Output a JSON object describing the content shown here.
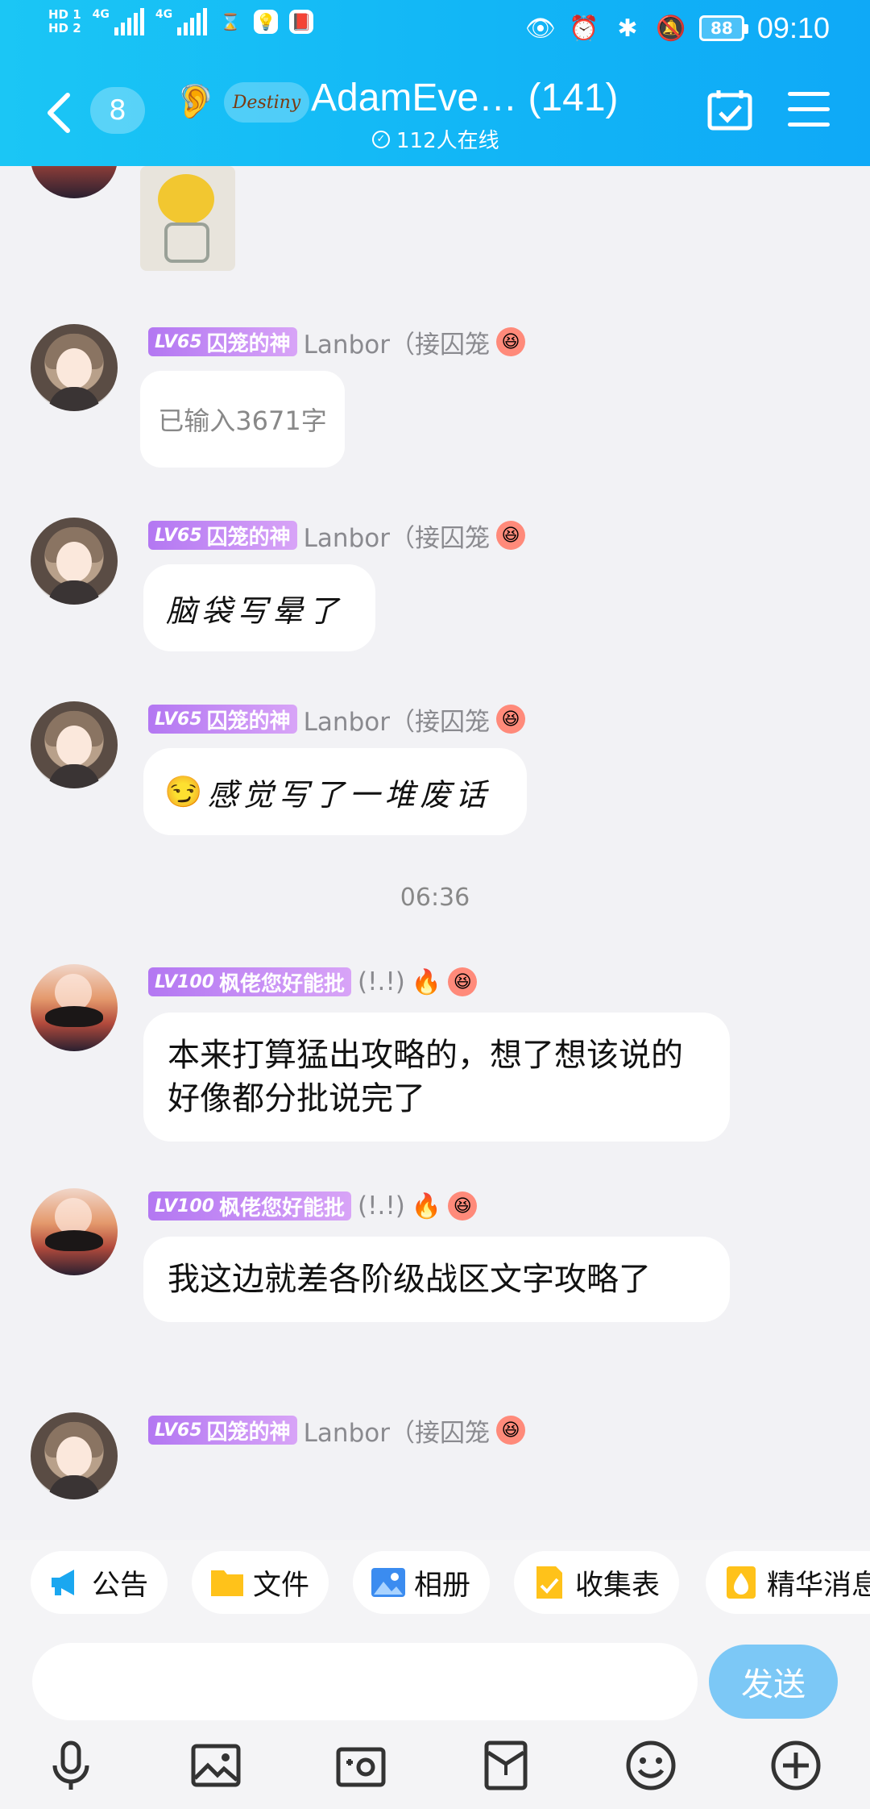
{
  "status_bar": {
    "sim1": "HD 1",
    "sim2": "HD 2",
    "network1": "4G",
    "network2": "4G",
    "battery": "88",
    "time": "09:10"
  },
  "header": {
    "unread_count": "8",
    "group_logo_text": "Destiny",
    "group_title": "AdamEve… (141)",
    "online_text": "112人在线"
  },
  "messages": [
    {
      "type": "sticker"
    },
    {
      "badge_level": "LV65",
      "badge_title": "囚笼的神",
      "nick": "Lanbor（接囚笼",
      "text": "已输入3671字"
    },
    {
      "badge_level": "LV65",
      "badge_title": "囚笼的神",
      "nick": "Lanbor（接囚笼",
      "text": "脑袋写晕了"
    },
    {
      "badge_level": "LV65",
      "badge_title": "囚笼的神",
      "nick": "Lanbor（接囚笼",
      "text": "感觉写了一堆废话"
    },
    {
      "badge_level": "LV100",
      "badge_title": "枫佬您好能批",
      "nick": "(!.!)",
      "text": "本来打算猛出攻略的，想了想该说的好像都分批说完了"
    },
    {
      "badge_level": "LV100",
      "badge_title": "枫佬您好能批",
      "nick": "(!.!)",
      "text": "我这边就差各阶级战区文字攻略了"
    },
    {
      "badge_level": "LV65",
      "badge_title": "囚笼的神",
      "nick": "Lanbor（接囚笼"
    }
  ],
  "timestamp": "06:36",
  "shortcuts": [
    {
      "label": "公告",
      "icon": "megaphone-icon",
      "color": "#1aa7f0"
    },
    {
      "label": "文件",
      "icon": "folder-icon",
      "color": "#ffc21a"
    },
    {
      "label": "相册",
      "icon": "photo-album-icon",
      "color": "#3b8cf0"
    },
    {
      "label": "收集表",
      "icon": "form-icon",
      "color": "#ffc21a"
    },
    {
      "label": "精华消息",
      "icon": "essence-icon",
      "color": "#ffc21a"
    }
  ],
  "input": {
    "placeholder": "",
    "send_label": "发送"
  },
  "toolbar": [
    "microphone-icon",
    "image-icon",
    "camera-icon",
    "red-packet-icon",
    "emoji-icon",
    "plus-icon"
  ]
}
